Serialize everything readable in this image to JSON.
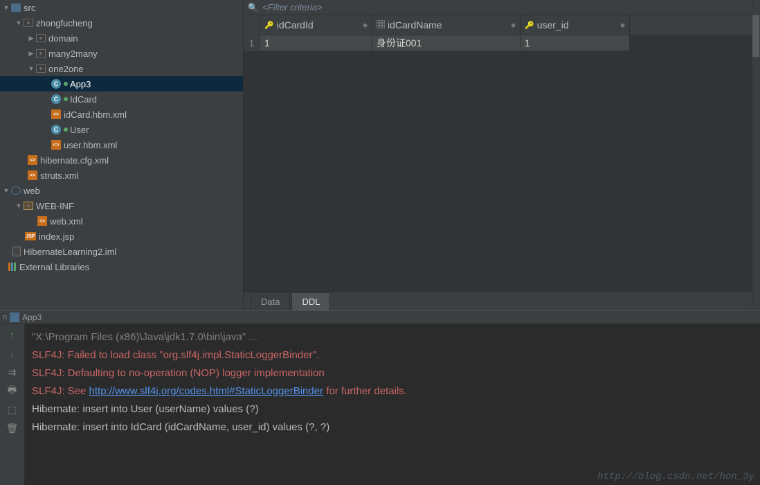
{
  "sidebar": {
    "src": "src",
    "zhongfucheng": "zhongfucheng",
    "domain": "domain",
    "many2many": "many2many",
    "one2one": "one2one",
    "app3": "App3",
    "idcard": "IdCard",
    "idcard_hbm": "idCard.hbm.xml",
    "user": "User",
    "user_hbm": "user.hbm.xml",
    "hibernate_cfg": "hibernate.cfg.xml",
    "struts_xml": "struts.xml",
    "web": "web",
    "webinf": "WEB-INF",
    "web_xml": "web.xml",
    "index_jsp": "index.jsp",
    "hl_iml": "HibernateLearning2.iml",
    "ext_libs": "External Libraries"
  },
  "filter": {
    "placeholder": "<Filter criteria>"
  },
  "grid": {
    "col1": "idCardId",
    "col2": "idCardName",
    "col3": "user_id",
    "row1": {
      "num": "1",
      "c1": "1",
      "c2": "身份证001",
      "c3": "1"
    }
  },
  "tabs": {
    "data": "Data",
    "ddl": "DDL"
  },
  "runbar": {
    "label": "App3"
  },
  "console": {
    "l1": "\"X:\\Program Files (x86)\\Java\\jdk1.7.0\\bin\\java\" ...",
    "l2a": "SLF4J: Failed to load class \"org.slf4j.impl.StaticLoggerBinder\".",
    "l3a": "SLF4J: Defaulting to no-operation (NOP) logger implementation",
    "l4a": "SLF4J: See ",
    "l4link": "http://www.slf4j.org/codes.html#StaticLoggerBinder",
    "l4b": " for further details.",
    "l5": "Hibernate: insert into User (userName) values (?)",
    "l6": "Hibernate: insert into IdCard (idCardName, user_id) values (?, ?)"
  },
  "watermark": "http://blog.csdn.net/hon_3y"
}
